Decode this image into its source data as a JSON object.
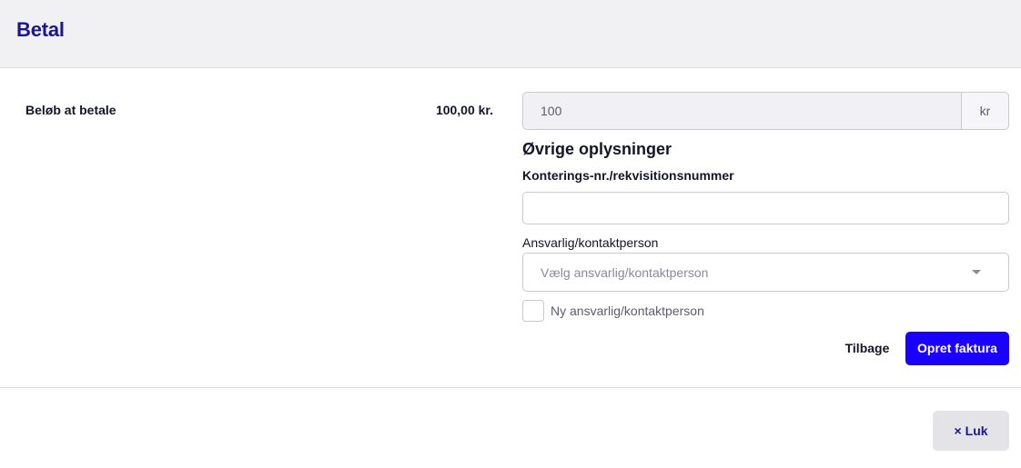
{
  "header": {
    "title": "Betal"
  },
  "amount": {
    "label": "Beløb at betale",
    "display_value": "100,00 kr.",
    "input_value": "100",
    "unit": "kr"
  },
  "other_info": {
    "heading": "Øvrige oplysninger",
    "reference_label": "Konterings-nr./rekvisitionsnummer",
    "reference_value": "",
    "contact_label": "Ansvarlig/kontaktperson",
    "contact_placeholder": "Vælg ansvarlig/kontaktperson",
    "new_contact_label": "Ny ansvarlig/kontaktperson",
    "new_contact_checked": false
  },
  "actions": {
    "back_label": "Tilbage",
    "create_invoice_label": "Opret faktura"
  },
  "footer": {
    "close_icon": "×",
    "close_label": "Luk"
  },
  "colors": {
    "title": "#1c1691",
    "primary": "#1a00ff",
    "header_bg": "#f1f1f3"
  }
}
